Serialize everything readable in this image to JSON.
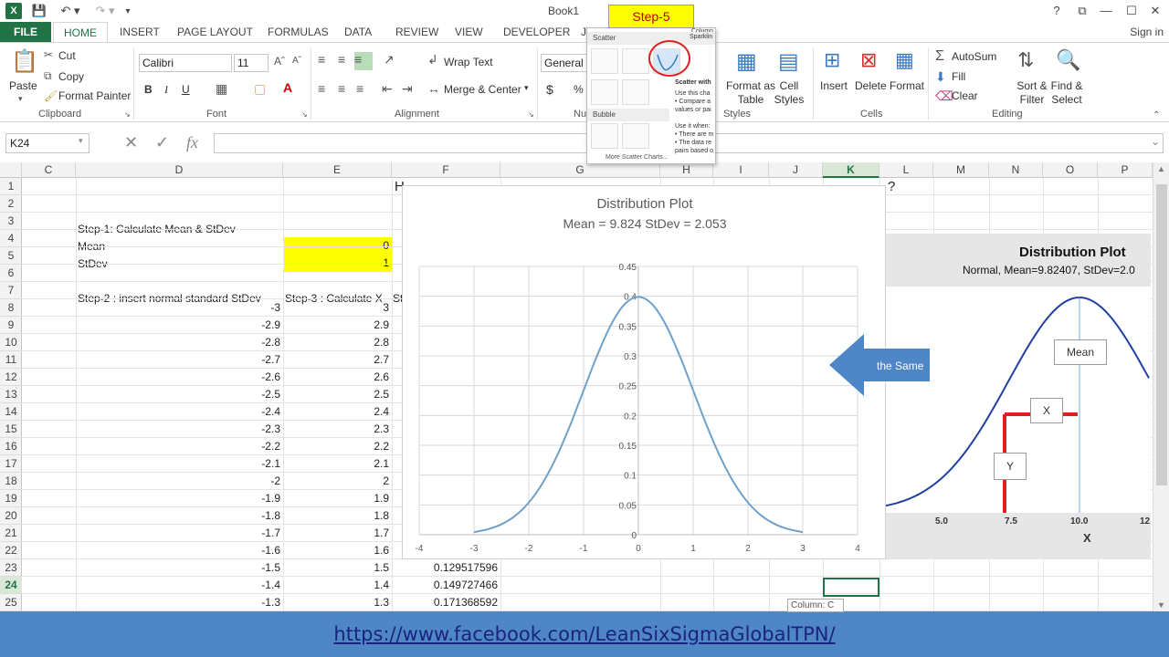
{
  "window": {
    "title": "Book1",
    "help": "?",
    "restore": "⧉",
    "minimize": "—",
    "maximize": "☐"
  },
  "tabs": {
    "file": "FILE",
    "home": "HOME",
    "insert": "INSERT",
    "page_layout": "PAGE LAYOUT",
    "formulas": "FORMULAS",
    "data": "DATA",
    "review": "REVIEW",
    "view": "VIEW",
    "developer": "DEVELOPER",
    "cut_tab": "J",
    "sign_in": "Sign in"
  },
  "ribbon": {
    "clipboard": {
      "paste": "Paste",
      "cut": "Cut",
      "copy": "Copy",
      "format_painter": "Format Painter",
      "label": "Clipboard"
    },
    "font": {
      "name": "Calibri",
      "size": "11",
      "bold": "B",
      "italic": "I",
      "underline": "U",
      "label": "Font"
    },
    "alignment": {
      "wrap_text": "Wrap Text",
      "merge_center": "Merge & Center",
      "label": "Alignment"
    },
    "number": {
      "format": "General",
      "currency": "$",
      "percent": "%",
      "label": "Nu"
    },
    "styles": {
      "format_as_table": "Format as Table",
      "cell_styles": "Cell Styles",
      "label": "Styles"
    },
    "cells": {
      "insert": "Insert",
      "delete": "Delete",
      "format": "Format",
      "label": "Cells"
    },
    "editing": {
      "autosum": "AutoSum",
      "fill": "Fill",
      "clear": "Clear",
      "sort_filter": "Sort & Filter",
      "find_select": "Find & Select",
      "label": "Editing"
    }
  },
  "scatter_panel": {
    "step_label": "Step-5",
    "scatter_header": "Scatter",
    "bubble_header": "Bubble",
    "more": "More Scatter Charts...",
    "column_label": "Column",
    "sparkline_label": "Sparklin",
    "tooltip_title": "Scatter with",
    "tooltip_lines": [
      "Use this cha",
      "• Compare a",
      "values or pai",
      "",
      "Use it when:",
      "• There are m",
      "• The data re",
      "pairs based o"
    ]
  },
  "formula_bar": {
    "name_box": "K24",
    "fx": "fx"
  },
  "columns": [
    "C",
    "D",
    "E",
    "F",
    "G",
    "H",
    "I",
    "J",
    "K",
    "L",
    "M",
    "N",
    "O",
    "P"
  ],
  "rows": [
    "1",
    "2",
    "3",
    "4",
    "5",
    "6",
    "7",
    "8",
    "9",
    "10",
    "11",
    "12",
    "13",
    "14",
    "15",
    "16",
    "17",
    "18",
    "19",
    "20",
    "21",
    "22",
    "23",
    "24",
    "25"
  ],
  "sheet": {
    "row1_text": "H",
    "row1_text_end": "?",
    "step1": "Step-1: Calculate Mean & StDev",
    "mean_label": "Mean",
    "mean_value": "0",
    "stdev_label": "StDev",
    "stdev_value": "1",
    "step2": "Step-2 : insert normal standard StDev",
    "step3": "Step-3 : Calculate X",
    "step4_cut": "St",
    "d_values": [
      "-3",
      "-2.9",
      "-2.8",
      "-2.7",
      "-2.6",
      "-2.5",
      "-2.4",
      "-2.3",
      "-2.2",
      "-2.1",
      "-2",
      "-1.9",
      "-1.8",
      "-1.7",
      "-1.6",
      "-1.5",
      "-1.4",
      "-1.3"
    ],
    "e_values": [
      "3",
      "2.9",
      "2.8",
      "2.7",
      "2.6",
      "2.5",
      "2.4",
      "2.3",
      "2.2",
      "2.1",
      "2",
      "1.9",
      "1.8",
      "1.7",
      "1.6",
      "1.5",
      "1.4",
      "1.3"
    ],
    "f_values": [
      "0.129517596",
      "0.149727466",
      "0.171368592"
    ]
  },
  "chart_data": {
    "type": "scatter",
    "title": "Distribution Plot",
    "subtitle": "Mean = 9.824 StDev = 2.053",
    "xlim": [
      -4,
      4
    ],
    "ylim": [
      0,
      0.45
    ],
    "x_ticks": [
      "-4",
      "-3",
      "-2",
      "-1",
      "0",
      "1",
      "2",
      "3",
      "4"
    ],
    "y_ticks": [
      "0",
      "0.05",
      "0.1",
      "0.15",
      "0.2",
      "0.25",
      "0.3",
      "0.35",
      "0.4",
      "0.45"
    ],
    "series": [
      {
        "x": [
          -3,
          -2.75,
          -2.5,
          -2.25,
          -2,
          -1.75,
          -1.5,
          -1.25,
          -1,
          -0.75,
          -0.5,
          -0.25,
          0,
          0.25,
          0.5,
          0.75,
          1,
          1.25,
          1.5,
          1.75,
          2,
          2.25,
          2.5,
          2.75,
          3
        ],
        "values": [
          0.0044,
          0.0091,
          0.0175,
          0.0317,
          0.054,
          0.0863,
          0.1295,
          0.1826,
          0.242,
          0.3011,
          0.3521,
          0.3867,
          0.3989,
          0.3867,
          0.3521,
          0.3011,
          0.242,
          0.1826,
          0.1295,
          0.0863,
          0.054,
          0.0317,
          0.0175,
          0.0091,
          0.0044
        ]
      }
    ],
    "grid": true,
    "line_color": "#6fa0c8"
  },
  "callout": {
    "text": "the Same",
    "color": "#4f86c6"
  },
  "minitab": {
    "title": "Distribution Plot",
    "subtitle": "Normal, Mean=9.82407, StDev=2.0",
    "x_ticks": [
      "5.0",
      "7.5",
      "10.0",
      "12"
    ],
    "x_label": "X",
    "mean_box": "Mean",
    "x_box": "X",
    "y_box": "Y"
  },
  "tooltip": {
    "column": "Column: C"
  },
  "footer": {
    "link": "https://www.facebook.com/LeanSixSigmaGlobalTPN/"
  }
}
